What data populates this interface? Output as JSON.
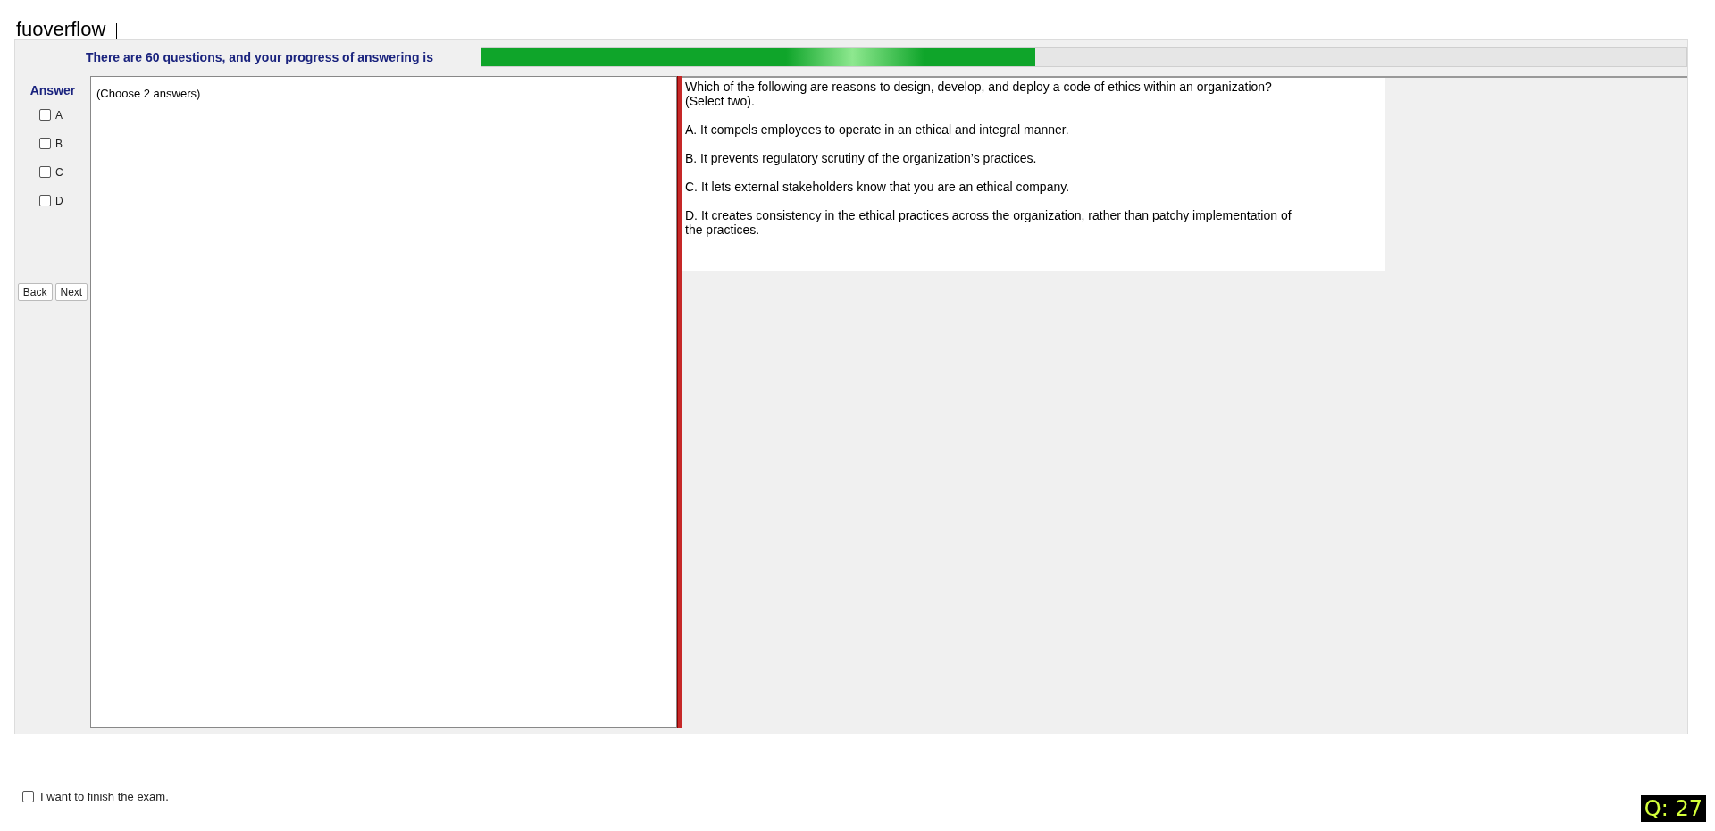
{
  "header": {
    "title": "fuoverflow"
  },
  "progress": {
    "label": "There are 60 questions, and your progress of answering is",
    "level": 0.46
  },
  "answer_panel": {
    "title": "Answer",
    "options": [
      {
        "label": "A",
        "checked": false
      },
      {
        "label": "B",
        "checked": false
      },
      {
        "label": "C",
        "checked": false
      },
      {
        "label": "D",
        "checked": false
      }
    ],
    "buttons": [
      "Back",
      "Next"
    ]
  },
  "notes": {
    "text": "(Choose 2 answers)"
  },
  "question": {
    "lines": [
      "Which of the following are reasons to design, develop, and deploy a code of ethics within an organization?\n(Select two).",
      "A.  It compels employees to operate in an ethical and integral manner.",
      "B.  It prevents regulatory scrutiny of the organization’s practices.",
      "C.  It lets external stakeholders know that you are an ethical company.",
      "D.  It creates consistency in the ethical practices across the organization, rather than patchy implementation of\nthe practices."
    ]
  },
  "finish": {
    "label": "I want to finish the exam.",
    "checked": false
  },
  "counter": {
    "text": "Q: 27"
  }
}
